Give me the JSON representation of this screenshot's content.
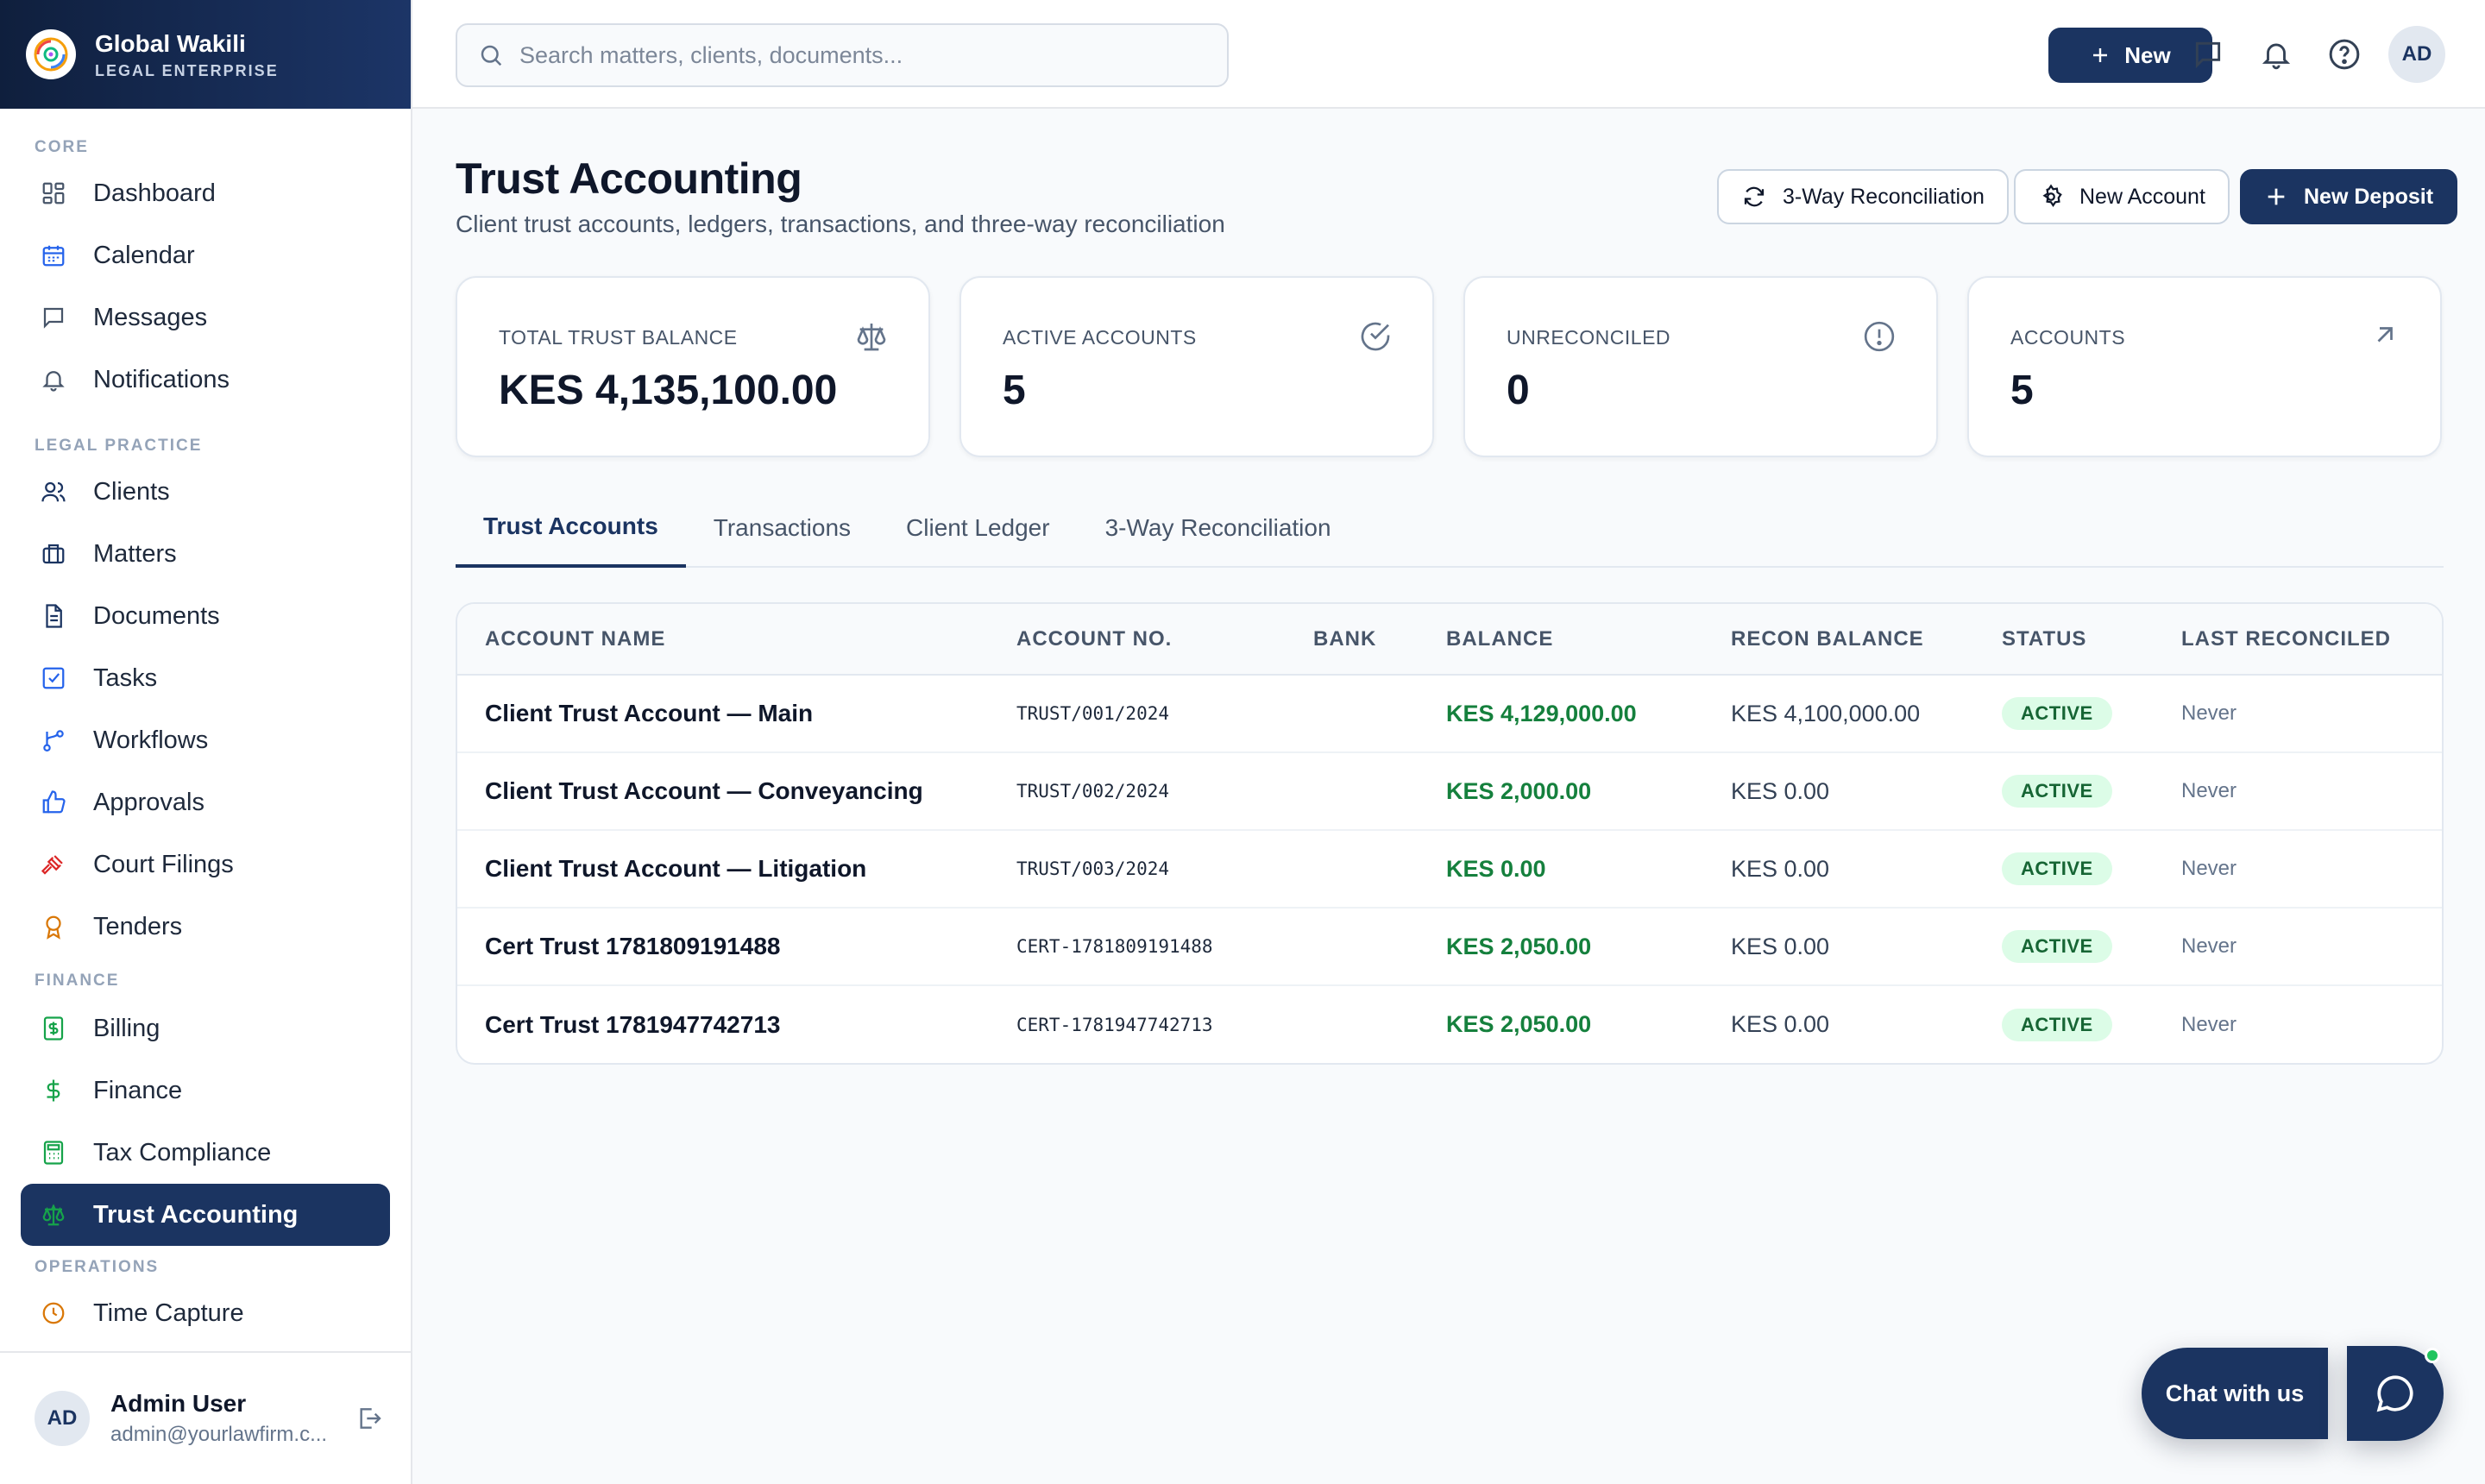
{
  "brand": {
    "name": "Global Wakili",
    "subtitle": "LEGAL ENTERPRISE"
  },
  "sidebar": {
    "sections": [
      {
        "title": "CORE",
        "items": [
          {
            "label": "Dashboard",
            "icon": "dashboard-icon"
          },
          {
            "label": "Calendar",
            "icon": "calendar-icon"
          },
          {
            "label": "Messages",
            "icon": "messages-icon"
          },
          {
            "label": "Notifications",
            "icon": "bell-icon"
          }
        ]
      },
      {
        "title": "LEGAL PRACTICE",
        "items": [
          {
            "label": "Clients",
            "icon": "users-icon"
          },
          {
            "label": "Matters",
            "icon": "briefcase-icon"
          },
          {
            "label": "Documents",
            "icon": "document-icon"
          },
          {
            "label": "Tasks",
            "icon": "task-icon"
          },
          {
            "label": "Workflows",
            "icon": "workflow-icon"
          },
          {
            "label": "Approvals",
            "icon": "thumbs-up-icon"
          },
          {
            "label": "Court Filings",
            "icon": "gavel-icon"
          },
          {
            "label": "Tenders",
            "icon": "award-icon"
          }
        ]
      },
      {
        "title": "FINANCE",
        "items": [
          {
            "label": "Billing",
            "icon": "receipt-icon"
          },
          {
            "label": "Finance",
            "icon": "dollar-icon"
          },
          {
            "label": "Tax Compliance",
            "icon": "calculator-icon"
          },
          {
            "label": "Trust Accounting",
            "icon": "scale-icon",
            "active": true
          }
        ]
      },
      {
        "title": "OPERATIONS",
        "items": [
          {
            "label": "Time Capture",
            "icon": "clock-icon"
          }
        ]
      }
    ]
  },
  "user": {
    "initials": "AD",
    "name": "Admin User",
    "email": "admin@yourlawfirm.c..."
  },
  "topbar": {
    "search_placeholder": "Search matters, clients, documents...",
    "new_label": "New",
    "avatar_initials": "AD"
  },
  "page": {
    "title": "Trust Accounting",
    "subtitle": "Client trust accounts, ledgers, transactions, and three-way reconciliation",
    "actions": {
      "reconciliation": "3-Way Reconciliation",
      "new_account": "New Account",
      "new_deposit": "New Deposit"
    }
  },
  "stats": [
    {
      "label": "TOTAL TRUST BALANCE",
      "value": "KES 4,135,100.00",
      "icon": "scale-icon"
    },
    {
      "label": "ACTIVE ACCOUNTS",
      "value": "5",
      "icon": "check-circle-icon"
    },
    {
      "label": "UNRECONCILED",
      "value": "0",
      "icon": "alert-circle-icon"
    },
    {
      "label": "ACCOUNTS",
      "value": "5",
      "icon": "arrow-up-right-icon"
    }
  ],
  "tabs": [
    "Trust Accounts",
    "Transactions",
    "Client Ledger",
    "3-Way Reconciliation"
  ],
  "table": {
    "headers": [
      "ACCOUNT NAME",
      "ACCOUNT NO.",
      "BANK",
      "BALANCE",
      "RECON BALANCE",
      "STATUS",
      "LAST RECONCILED"
    ],
    "rows": [
      {
        "name": "Client Trust Account — Main",
        "number": "TRUST/001/2024",
        "bank": "",
        "balance": "KES 4,129,000.00",
        "recon": "KES 4,100,000.00",
        "status": "ACTIVE",
        "last": "Never"
      },
      {
        "name": "Client Trust Account — Conveyancing",
        "number": "TRUST/002/2024",
        "bank": "",
        "balance": "KES 2,000.00",
        "recon": "KES 0.00",
        "status": "ACTIVE",
        "last": "Never"
      },
      {
        "name": "Client Trust Account — Litigation",
        "number": "TRUST/003/2024",
        "bank": "",
        "balance": "KES 0.00",
        "recon": "KES 0.00",
        "status": "ACTIVE",
        "last": "Never"
      },
      {
        "name": "Cert Trust 1781809191488",
        "number": "CERT-1781809191488",
        "bank": "",
        "balance": "KES 2,050.00",
        "recon": "KES 0.00",
        "status": "ACTIVE",
        "last": "Never"
      },
      {
        "name": "Cert Trust 1781947742713",
        "number": "CERT-1781947742713",
        "bank": "",
        "balance": "KES 2,050.00",
        "recon": "KES 0.00",
        "status": "ACTIVE",
        "last": "Never"
      }
    ]
  },
  "chat": {
    "label": "Chat with us"
  },
  "colors": {
    "navy": "#1b3461",
    "positive": "#15803d",
    "badge_bg": "#dcfce7",
    "online": "#22c55e"
  }
}
